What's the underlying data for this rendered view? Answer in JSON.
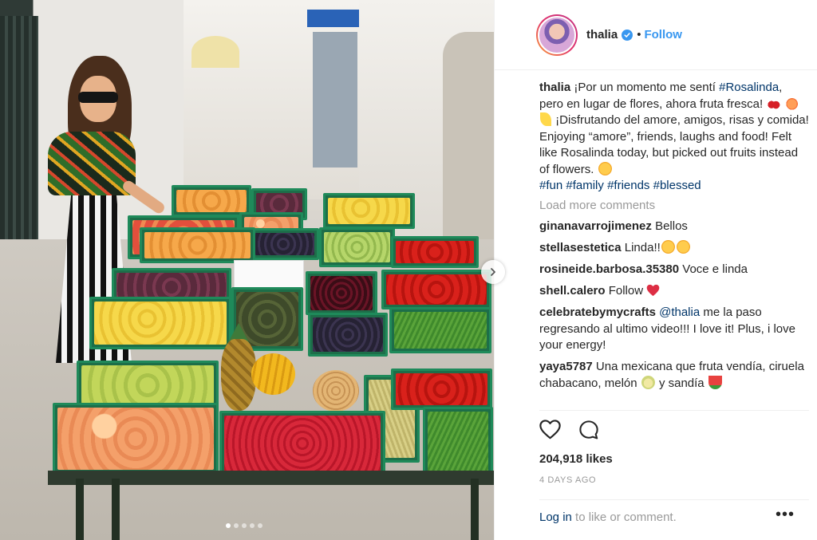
{
  "photo": {
    "dots": [
      true,
      false,
      false,
      false,
      false
    ]
  },
  "header": {
    "username": "thalia",
    "separator": "•",
    "follow_label": "Follow"
  },
  "caption": {
    "username": "thalia",
    "text_1": "¡Por un momento me sentí",
    "hashtag_1": "#Rosalinda",
    "text_2": ", pero en lugar de flores, ahora fruta fresca!",
    "text_3": "¡Disfrutando del amore, amigos, risas y comida! Enjoying “amore”, friends, laughs and food! Felt like Rosalinda today, but picked out fruits instead of flowers.",
    "hashtags_end": [
      "#fun",
      "#family",
      "#friends",
      "#blessed"
    ]
  },
  "load_more_label": "Load more comments",
  "comments": [
    {
      "user": "ginanavarrojimenez",
      "text": "Bellos"
    },
    {
      "user": "stellasestetica",
      "text": "Linda!!"
    },
    {
      "user": "rosineide.barbosa.35380",
      "text": "Voce e linda"
    },
    {
      "user": "shell.calero",
      "text": "Follow"
    },
    {
      "user": "celebratebymycrafts",
      "mention": "@thalia",
      "text": "me la paso regresando al ultimo video!!! I love it! Plus, i love your energy!"
    },
    {
      "user": "yaya5787",
      "text": "Una mexicana que fruta vendía, ciruela chabacano, melón",
      "text_tail": "y sandía"
    }
  ],
  "likes": "204,918 likes",
  "timestamp": "4 DAYS AGO",
  "login": {
    "link": "Log in",
    "text": "to like or comment."
  },
  "more_label": "•••",
  "colors": {
    "link_blue": "#3897f0",
    "hashtag_navy": "#003569",
    "muted_gray": "#999999",
    "text_dark": "#262626",
    "heart_red": "#ed4956"
  },
  "icons": {
    "like": "heart-outline-icon",
    "comment": "speech-bubble-icon",
    "verified": "verified-badge-icon",
    "next": "chevron-right-icon"
  }
}
